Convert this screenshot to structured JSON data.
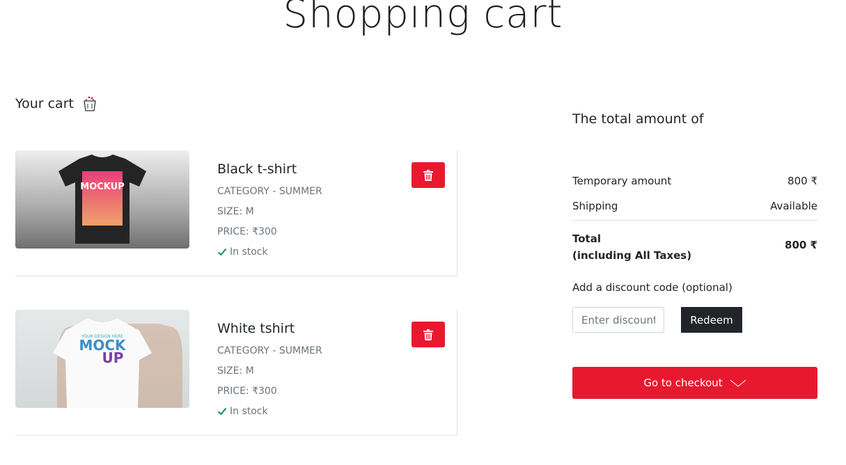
{
  "page": {
    "title": "Shopping cart"
  },
  "cart": {
    "heading": "Your cart",
    "items": [
      {
        "name": "Black t-shirt",
        "category": "CATEGORY - SUMMER",
        "size": "SIZE: M",
        "price": "PRICE: ₹300",
        "stock": "In stock",
        "image_text": "MOCKUP"
      },
      {
        "name": "White tshirt",
        "category": "CATEGORY - SUMMER",
        "size": "SIZE: M",
        "price": "PRICE: ₹300",
        "stock": "In stock",
        "image_text_top": "YOUR DESIGN HERE",
        "image_text_mid": "MOCK",
        "image_text_bottom": "UP"
      }
    ]
  },
  "summary": {
    "title": "The total amount of",
    "temporary_label": "Temporary amount",
    "temporary_value": "800 ₹",
    "shipping_label": "Shipping",
    "shipping_value": "Available",
    "total_label_line1": "Total",
    "total_label_line2": "(including All Taxes)",
    "total_value": "800 ₹"
  },
  "discount": {
    "label": "Add a discount code (optional)",
    "placeholder": "Enter discount code",
    "redeem_label": "Redeem"
  },
  "checkout": {
    "label": "Go to checkout"
  },
  "colors": {
    "accent": "#e8192f",
    "dark": "#212529",
    "success": "#198754"
  }
}
